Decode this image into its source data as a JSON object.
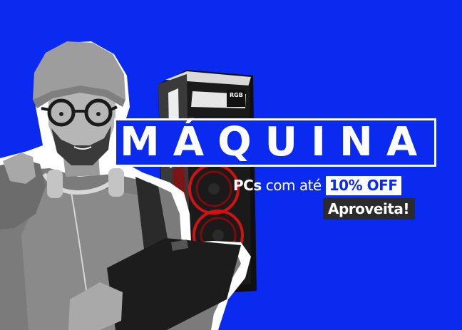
{
  "banner": {
    "background_color": "#0a2af0",
    "title": "MÁQUINA",
    "offer": {
      "highlight": "PCs",
      "text": "com até",
      "discount": "10% OFF"
    },
    "cta": "Aproveita!",
    "pc_case": {
      "label_top": "RGB",
      "icon": "pc-tower-icon"
    },
    "person": {
      "icon": "person-photo"
    }
  }
}
